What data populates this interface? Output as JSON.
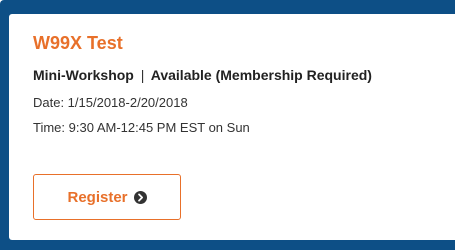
{
  "event": {
    "title": "W99X Test",
    "type": "Mini-Workshop",
    "separator": "|",
    "availability": "Available (Membership Required)",
    "date_text": "Date: 1/15/2018-2/20/2018",
    "time_text": "Time: 9:30 AM-12:45 PM EST on Sun",
    "register_label": "Register",
    "register_icon": "circle-chevron-right-icon"
  },
  "colors": {
    "frame": "#0d4f86",
    "accent": "#e8702a",
    "text": "#333333"
  }
}
